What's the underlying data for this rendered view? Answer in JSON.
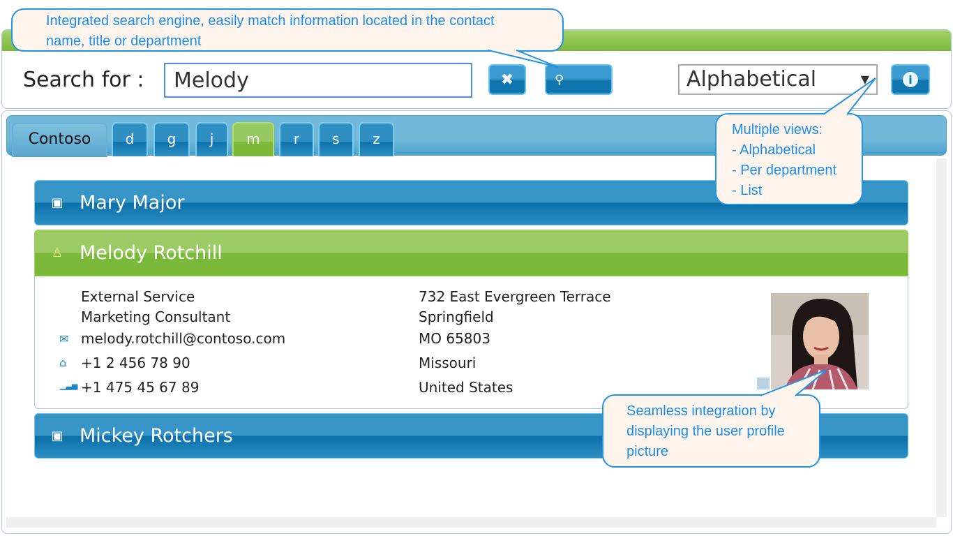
{
  "search": {
    "label": "Search for :",
    "value": "Melody",
    "clear_icon": "close-icon",
    "search_icon": "search-icon"
  },
  "view": {
    "selected": "Alphabetical",
    "info_icon": "info-icon"
  },
  "tabs": [
    {
      "label": "Contoso"
    },
    {
      "label": "d"
    },
    {
      "label": "g"
    },
    {
      "label": "j"
    },
    {
      "label": "m",
      "active": true
    },
    {
      "label": "r"
    },
    {
      "label": "s"
    },
    {
      "label": "z"
    }
  ],
  "contacts": [
    {
      "name": "Mary Major",
      "icon": "contact-card-icon"
    },
    {
      "name": "Melody Rotchill",
      "icon": "person-icon",
      "expanded": true,
      "department": "External Service",
      "title": "Marketing Consultant",
      "email": "melody.rotchill@contoso.com",
      "home_phone": "+1 2 456 78 90",
      "mobile_phone": "+1 475 45 67 89",
      "address": [
        "732 East Evergreen Terrace",
        "Springfield",
        "MO 65803",
        "Missouri",
        "United States"
      ]
    },
    {
      "name": "Mickey Rotchers",
      "icon": "contact-card-icon"
    }
  ],
  "callouts": {
    "search": "Integrated search engine, easily match information located in the contact name, title or department",
    "views": [
      "Multiple views:",
      "- Alphabetical",
      "- Per department",
      "- List"
    ],
    "picture": "Seamless integration by displaying the user profile picture"
  },
  "colors": {
    "accent_blue": "#2a8cc2",
    "accent_green": "#7cb83a",
    "callout_text": "#1a8ef0"
  }
}
